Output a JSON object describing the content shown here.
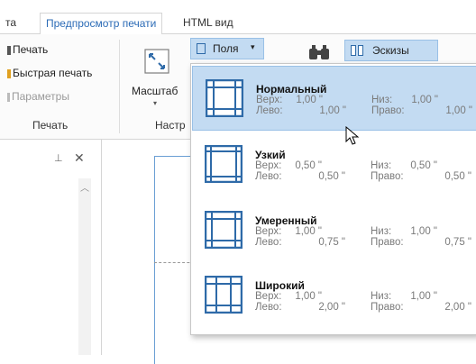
{
  "tabs": [
    {
      "label": "та",
      "active": false
    },
    {
      "label": "Предпросмотр печати",
      "active": true
    },
    {
      "label": "HTML вид",
      "active": false
    }
  ],
  "ribbon": {
    "print_group": {
      "items": [
        "Печать",
        "Быстрая печать",
        "Параметры"
      ],
      "label": "Печать"
    },
    "scale_label": "Масштаб",
    "settings_group_label": "Настр",
    "margins_button": "Поля",
    "thumbnails_button": "Эскизы"
  },
  "panel": {
    "pin_icon": "pin-icon",
    "close_icon": "close-icon"
  },
  "margins": {
    "keys": {
      "top": "Верх:",
      "bottom": "Низ:",
      "left": "Лево:",
      "right": "Право:"
    },
    "options": [
      {
        "name": "Нормальный",
        "top": "1,00 \"",
        "bottom": "1,00 \"",
        "left": "1,00 \"",
        "right": "1,00 \"",
        "selected": true
      },
      {
        "name": "Узкий",
        "top": "0,50 \"",
        "bottom": "0,50 \"",
        "left": "0,50 \"",
        "right": "0,50 \"",
        "selected": false
      },
      {
        "name": "Умеренный",
        "top": "1,00 \"",
        "bottom": "1,00 \"",
        "left": "0,75 \"",
        "right": "0,75 \"",
        "selected": false
      },
      {
        "name": "Широкий",
        "top": "1,00 \"",
        "bottom": "1,00 \"",
        "left": "2,00 \"",
        "right": "2,00 \"",
        "selected": false
      }
    ]
  },
  "colors": {
    "accent": "#2b6bb6",
    "selected_bg": "#c3dbf2",
    "icon_blue": "#2e6aa8"
  }
}
